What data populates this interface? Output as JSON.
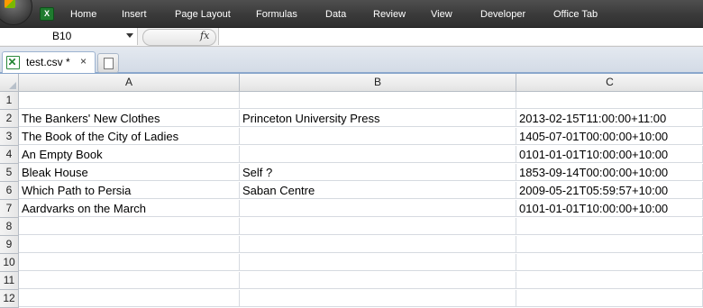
{
  "ribbon": {
    "tabs": [
      "Home",
      "Insert",
      "Page Layout",
      "Formulas",
      "Data",
      "Review",
      "View",
      "Developer",
      "Office Tab"
    ]
  },
  "formula_bar": {
    "name_box": "B10",
    "fx": "fx",
    "formula": ""
  },
  "tabs": {
    "document_tab": "test.csv *",
    "close": "×"
  },
  "sheet": {
    "columns": [
      "A",
      "B",
      "C"
    ],
    "rows": [
      {
        "num": "1",
        "a": "",
        "b": "",
        "c": ""
      },
      {
        "num": "2",
        "a": "The Bankers' New Clothes",
        "b": "Princeton University Press",
        "c": "2013-02-15T11:00:00+11:00"
      },
      {
        "num": "3",
        "a": "The Book of the City of Ladies",
        "b": "",
        "c": "1405-07-01T00:00:00+10:00"
      },
      {
        "num": "4",
        "a": "An Empty Book",
        "b": "",
        "c": "0101-01-01T10:00:00+10:00"
      },
      {
        "num": "5",
        "a": "Bleak House",
        "b": "Self ?",
        "c": "1853-09-14T00:00:00+10:00"
      },
      {
        "num": "6",
        "a": "Which Path to Persia",
        "b": "Saban Centre",
        "c": "2009-05-21T05:59:57+10:00"
      },
      {
        "num": "7",
        "a": "Aardvarks on the March",
        "b": "",
        "c": "0101-01-01T10:00:00+10:00"
      },
      {
        "num": "8",
        "a": "",
        "b": "",
        "c": ""
      },
      {
        "num": "9",
        "a": "",
        "b": "",
        "c": ""
      },
      {
        "num": "10",
        "a": "",
        "b": "",
        "c": ""
      },
      {
        "num": "11",
        "a": "",
        "b": "",
        "c": ""
      },
      {
        "num": "12",
        "a": "",
        "b": "",
        "c": ""
      }
    ]
  }
}
